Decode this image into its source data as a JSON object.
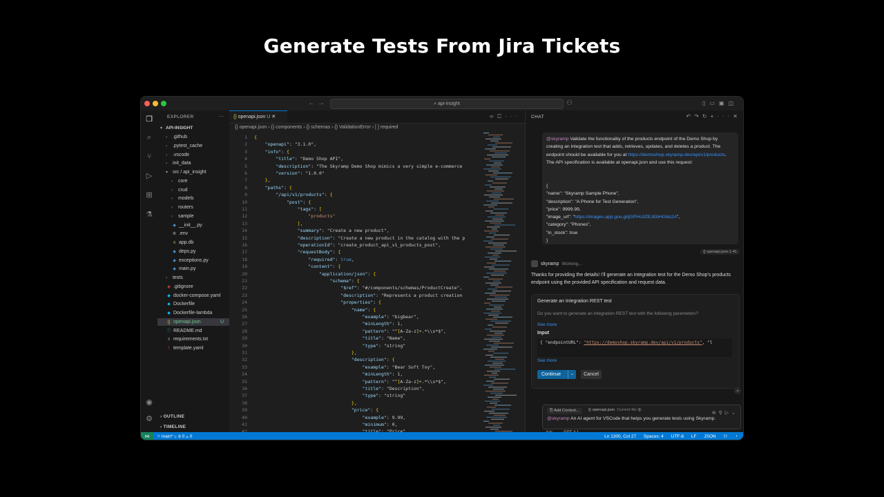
{
  "slide": {
    "title": "Generate Tests From Jira Tickets"
  },
  "window": {
    "search_text": "api-insight"
  },
  "explorer": {
    "header": "EXPLORER",
    "root": "API-INSIGHT",
    "items": [
      {
        "label": ".github",
        "indent": 1,
        "folder": true
      },
      {
        "label": ".pytest_cache",
        "indent": 1,
        "folder": true
      },
      {
        "label": ".vscode",
        "indent": 1,
        "folder": true
      },
      {
        "label": "init_data",
        "indent": 1,
        "folder": true
      },
      {
        "label": "src / api_insight",
        "indent": 1,
        "folder": true,
        "open": true
      },
      {
        "label": "core",
        "indent": 2,
        "folder": true
      },
      {
        "label": "crud",
        "indent": 2,
        "folder": true
      },
      {
        "label": "models",
        "indent": 2,
        "folder": true
      },
      {
        "label": "routers",
        "indent": 2,
        "folder": true
      },
      {
        "label": "sample",
        "indent": 2,
        "folder": true
      },
      {
        "label": "__init__.py",
        "indent": 2,
        "folder": false,
        "icon": "py"
      },
      {
        "label": ".env",
        "indent": 2,
        "folder": false,
        "icon": "gear"
      },
      {
        "label": "app.db",
        "indent": 2,
        "folder": false,
        "icon": "db"
      },
      {
        "label": "deps.py",
        "indent": 2,
        "folder": false,
        "icon": "py"
      },
      {
        "label": "exceptions.py",
        "indent": 2,
        "folder": false,
        "icon": "py"
      },
      {
        "label": "main.py",
        "indent": 2,
        "folder": false,
        "icon": "py"
      },
      {
        "label": "tests",
        "indent": 1,
        "folder": true
      },
      {
        "label": ".gitignore",
        "indent": 1,
        "folder": false,
        "icon": "git"
      },
      {
        "label": "docker-compose.yaml",
        "indent": 1,
        "folder": false,
        "icon": "docker"
      },
      {
        "label": "Dockerfile",
        "indent": 1,
        "folder": false,
        "icon": "docker"
      },
      {
        "label": "Dockerfile-lambda",
        "indent": 1,
        "folder": false,
        "icon": "docker"
      },
      {
        "label": "openapi.json",
        "indent": 1,
        "folder": false,
        "icon": "json",
        "selected": true,
        "badge": "U"
      },
      {
        "label": "README.md",
        "indent": 1,
        "folder": false,
        "icon": "md"
      },
      {
        "label": "requirements.txt",
        "indent": 1,
        "folder": false,
        "icon": "txt"
      },
      {
        "label": "template.yaml",
        "indent": 1,
        "folder": false,
        "icon": "yaml"
      }
    ],
    "outline": "OUTLINE",
    "timeline": "TIMELINE"
  },
  "editor": {
    "tab_label": "openapi.json",
    "tab_badge": "U",
    "breadcrumbs": "{} openapi.json  ›  {} components  ›  {} schemas  ›  {} ValidationError  ›  [ ] required",
    "lines": [
      "{",
      "    \"openapi\": \"3.1.0\",",
      "    \"info\": {",
      "        \"title\": \"Demo Shop API\",",
      "        \"description\": \"The Skyramp Demo Shop mimics a very simple e-commerce",
      "        \"version\": \"1.0.0\"",
      "    },",
      "    \"paths\": {",
      "        \"/api/v1/products\": {",
      "            \"post\": {",
      "                \"tags\": [",
      "                    \"products\"",
      "                ],",
      "                \"summary\": \"Create a new product\",",
      "                \"description\": \"Create a new product in the catalog with the p",
      "                \"operationId\": \"create_product_api_v1_products_post\",",
      "                \"requestBody\": {",
      "                    \"required\": true,",
      "                    \"content\": {",
      "                        \"application/json\": {",
      "                            \"schema\": {",
      "                                \"$ref\": \"#/components/schemas/ProductCreate\",",
      "                                \"description\": \"Represents a product creation",
      "                                \"properties\": {",
      "                                    \"name\": {",
      "                                        \"example\": \"bigbear\",",
      "                                        \"minLength\": 1,",
      "                                        \"pattern\": \"^[A-Za-z]+.*\\\\s*$\",",
      "                                        \"title\": \"Name\",",
      "                                        \"type\": \"string\"",
      "                                    },",
      "                                    \"description\": {",
      "                                        \"example\": \"Bear Soft Toy\",",
      "                                        \"minLength\": 1,",
      "                                        \"pattern\": \"^[A-Za-z]+.*\\\\s*$\",",
      "                                        \"title\": \"Description\",",
      "                                        \"type\": \"string\"",
      "                                    },",
      "                                    \"price\": {",
      "                                        \"example\": 9.99,",
      "                                        \"minimum\": 0,",
      "                                        \"title\": \"Price\","
    ]
  },
  "chat": {
    "header": "CHAT",
    "user_message": {
      "mention": "@skyramp",
      "text": " Validate the functionality of the products endpoint of the Demo Shop by creating an integration test that adds, retrieves, updates, and deletes a product. The endpoint should be available for you at ",
      "link": "https://demoshop.skyramp.dev/api/v1/products",
      "text2": ". The API specification is available at openapi.json and use this request:",
      "json_lines": [
        "{",
        "\"name\": \"Skyramp Sample Phone\",",
        "\"description\": \"A Phone for Test Generation\",",
        "\"price\": 9999.99,",
        "\"image_url\": \"https://images.app.goo.gl/jGPHo3ZEzEbHG8o2A\",",
        "\"category\": \"Phones\",",
        "\"in_stock\": true",
        "}"
      ],
      "ref": "{} openapi.json:1-41"
    },
    "agent": {
      "name": "skyramp",
      "status": "Working...",
      "text": "Thanks for providing the details! I'll generate an integration test for the Demo Shop's products endpoint using the provided API specification and request data."
    },
    "tool": {
      "title": "Generate an Integration REST test",
      "question": "Do you want to generate an integration REST test with the following parameters?",
      "see_more": "See more",
      "input_label": "Input",
      "input_key": "{ \"endpointURL\": ",
      "input_url": "\"https://demoshop.skyramp.dev/api/v1/products\"",
      "input_tail": ", \"l",
      "continue_label": "Continue",
      "cancel_label": "Cancel"
    },
    "input": {
      "add_context": "Add Context...",
      "file": "{} openapi.json",
      "current_file": "Current file",
      "mention": "@skyramp",
      "prompt": " An AI agent for VSCode that helps you generate tests using Skyramp.",
      "mode": "Ask",
      "model": "GPT-4.1"
    }
  },
  "statusbar": {
    "branch": "main*",
    "errors": "⊗ 0 ⚠ 0",
    "position": "Ln 1300, Col 27",
    "spaces": "Spaces: 4",
    "encoding": "UTF-8",
    "eol": "LF",
    "language": "JSON"
  },
  "colors": {
    "accent": "#0078d4",
    "mention": "#c586c0",
    "link": "#3794ff"
  }
}
